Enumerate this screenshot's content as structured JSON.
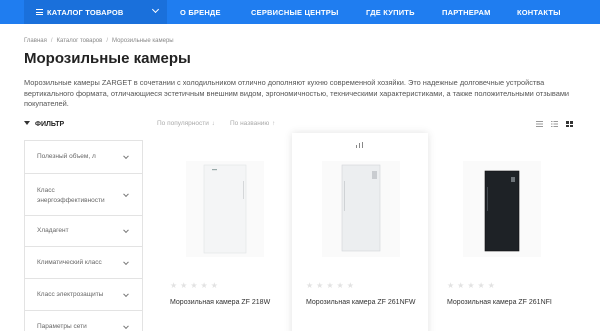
{
  "nav": {
    "catalog_label": "КАТАЛОГ ТОВАРОВ",
    "items": [
      "О БРЕНДЕ",
      "СЕРВИСНЫЕ ЦЕНТРЫ",
      "ГДЕ КУПИТЬ",
      "ПАРТНЕРАМ",
      "КОНТАКТЫ"
    ]
  },
  "breadcrumbs": [
    "Главная",
    "Каталог товаров",
    "Морозильные камеры"
  ],
  "page_title": "Морозильные камеры",
  "description": "Морозильные камеры ZARGET в сочетании с холодильником отлично дополняют кухню современной хозяйки. Это надежные долговечные устройства вертикального формата, отличающиеся эстетичным внешним видом, эргономичностью, техническими характеристиками, а также положительными отзывами покупателей.",
  "filter": {
    "title": "ФИЛЬТР",
    "items": [
      "Полезный объем, л",
      "Класс энергоэффективности",
      "Хладагент",
      "Климатический класс",
      "Класс электрозащиты",
      "Параметры сети"
    ]
  },
  "sort": {
    "by_popularity": "По популярности",
    "by_name": "По названию",
    "arrow_down": "↓",
    "arrow_up": "↑"
  },
  "view_icons": [
    "list-icon",
    "list-detailed-icon",
    "grid-icon"
  ],
  "products": [
    {
      "title": "Морозильная камера ZF 218W",
      "rating": 0,
      "color": "white"
    },
    {
      "title": "Морозильная камера ZF 261NFW",
      "rating": 0,
      "color": "white",
      "compare_icon": "compare-icon"
    },
    {
      "title": "Морозильная камера ZF 261NFI",
      "rating": 0,
      "color": "black"
    }
  ],
  "colors": {
    "accent": "#1f7df0",
    "accent_dark": "#1a70db"
  }
}
